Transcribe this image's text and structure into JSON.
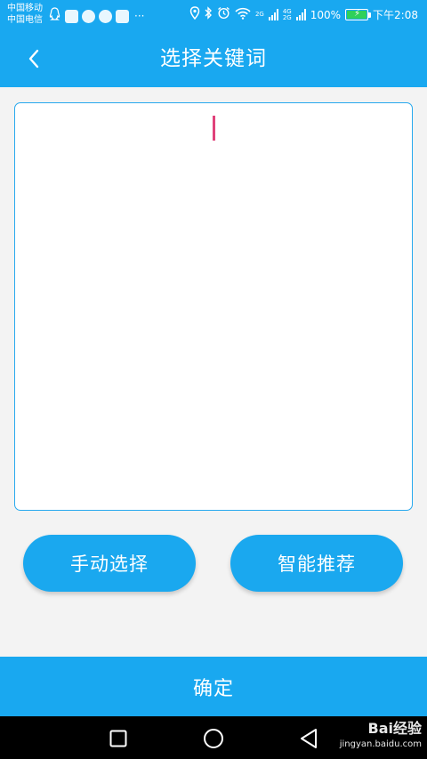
{
  "status_bar": {
    "carrier_1": "中国移动",
    "carrier_2": "中国电信",
    "more_notifications": "···",
    "network_1": "2G",
    "network_2": "4G",
    "network_3": "2G",
    "battery_text": "100%",
    "battery_level": 1.0,
    "time": "下午2:08",
    "icons": [
      "qq-icon",
      "app-icon",
      "message-bubble-icon",
      "browser-icon",
      "weibo-icon",
      "location-icon",
      "bluetooth-icon",
      "alarm-icon",
      "wifi-icon",
      "signal-icon",
      "battery-icon"
    ]
  },
  "header": {
    "title": "选择关键词",
    "back_icon": "chevron-left-icon"
  },
  "keyword_input": {
    "value": "",
    "caret_color": "#e0427a",
    "border_color": "#28a9ee"
  },
  "actions": {
    "manual_label": "手动选择",
    "smart_label": "智能推荐"
  },
  "confirm": {
    "label": "确定"
  },
  "nav_bar": {
    "icons": [
      "recent-apps-icon",
      "home-icon",
      "back-triangle-icon"
    ]
  },
  "watermark": {
    "brand": "Bai经验",
    "url": "jingyan.baidu.com"
  },
  "colors": {
    "primary": "#19a8f0",
    "background": "#f3f3f3"
  }
}
